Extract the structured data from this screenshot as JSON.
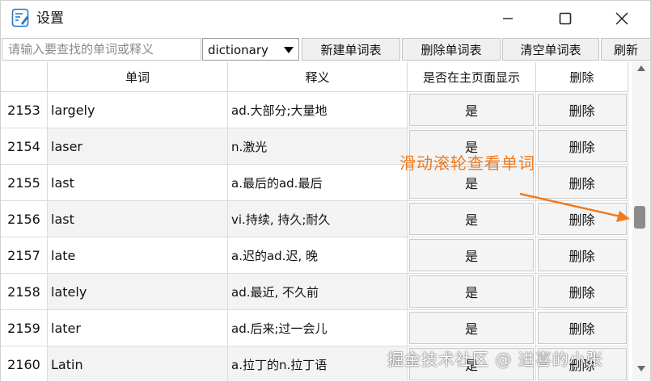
{
  "window": {
    "title": "设置",
    "icon": "notepad-icon"
  },
  "toolbar": {
    "search_placeholder": "请输入要查找的单词或释义",
    "dictionary_selected": "dictionary",
    "new_wordlist_label": "新建单词表",
    "delete_wordlist_label": "删除单词表",
    "clear_wordlist_label": "清空单词表",
    "refresh_label": "刷新"
  },
  "table": {
    "headers": [
      "",
      "单词",
      "释义",
      "是否在主页面显示",
      "删除"
    ],
    "rows": [
      {
        "index": "2153",
        "word": "largely",
        "definition": "ad.大部分;大量地",
        "show": "是",
        "delete": "删除"
      },
      {
        "index": "2154",
        "word": "laser",
        "definition": "n.激光",
        "show": "是",
        "delete": "删除"
      },
      {
        "index": "2155",
        "word": "last",
        "definition": "a.最后的ad.最后",
        "show": "是",
        "delete": "删除"
      },
      {
        "index": "2156",
        "word": "last",
        "definition": "vi.持续, 持久;耐久",
        "show": "是",
        "delete": "删除"
      },
      {
        "index": "2157",
        "word": "late",
        "definition": "a.迟的ad.迟, 晚",
        "show": "是",
        "delete": "删除"
      },
      {
        "index": "2158",
        "word": "lately",
        "definition": "ad.最近, 不久前",
        "show": "是",
        "delete": "删除"
      },
      {
        "index": "2159",
        "word": "later",
        "definition": "ad.后来;过一会儿",
        "show": "是",
        "delete": "删除"
      },
      {
        "index": "2160",
        "word": "Latin",
        "definition": "a.拉丁的n.拉丁语",
        "show": "是",
        "delete": "删除"
      }
    ]
  },
  "annotation": {
    "text": "滑动滚轮查看单词",
    "color": "#f07a1e"
  },
  "watermark": "掘金技术社区 @ 进喜的小张"
}
